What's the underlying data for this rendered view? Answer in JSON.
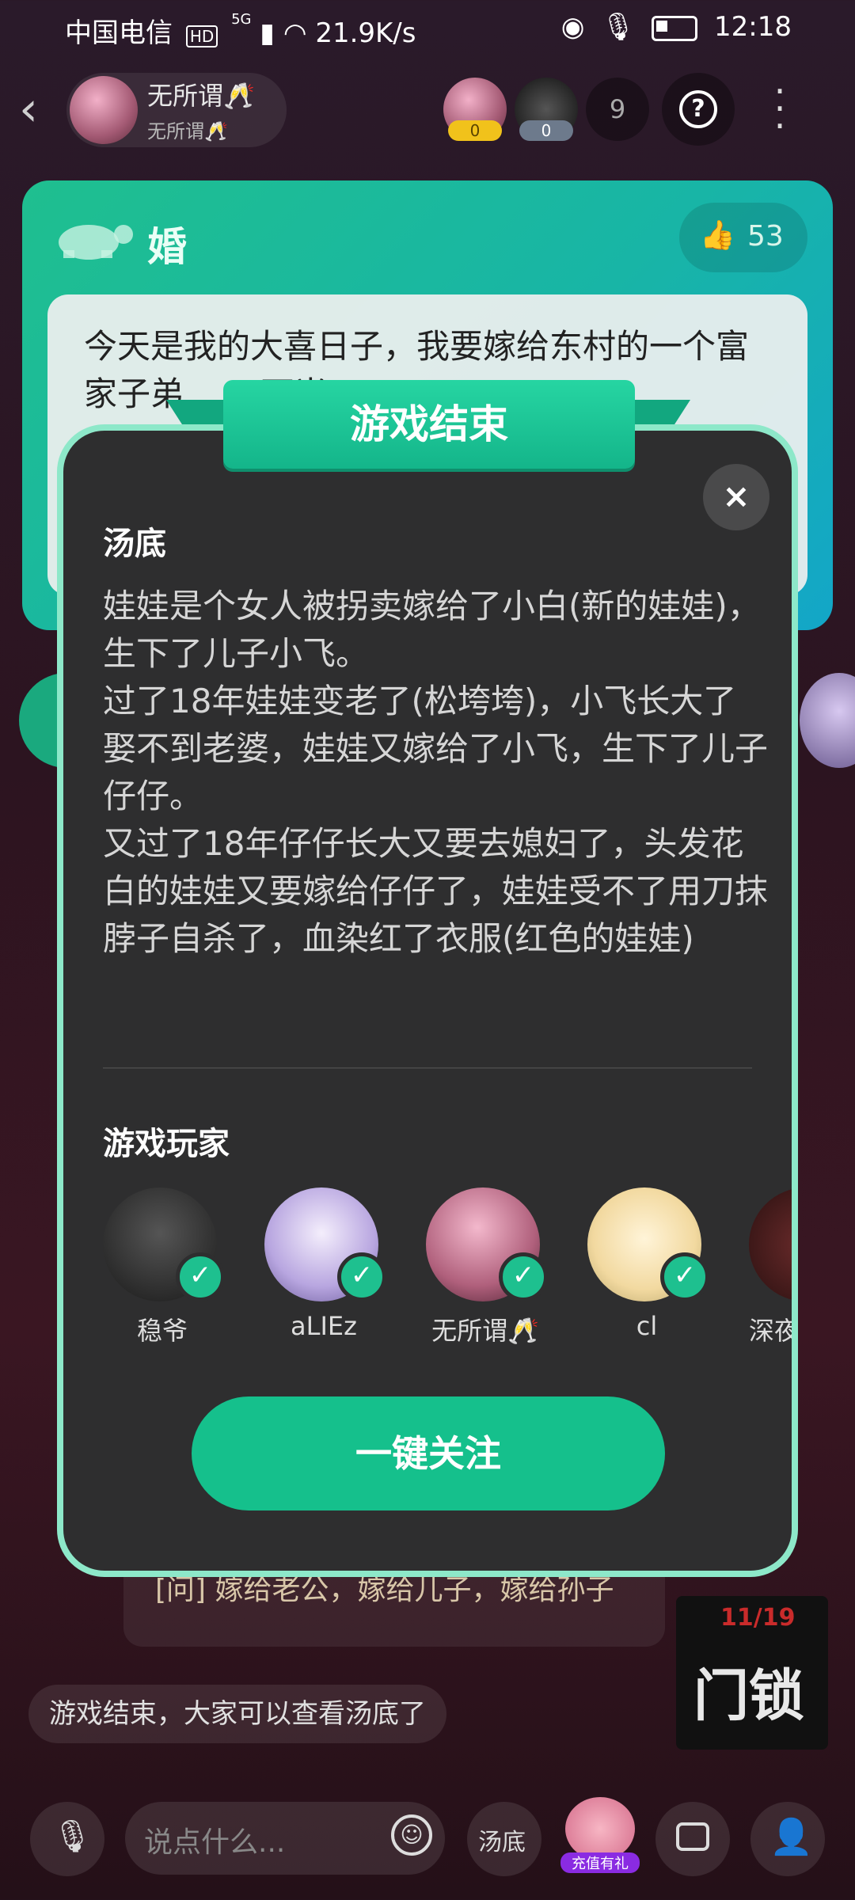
{
  "status_bar": {
    "carrier": "中国电信",
    "speed": "21.9K/s",
    "time": "12:18",
    "net": "5G"
  },
  "header": {
    "host_name": "无所谓🥂",
    "host_subtitle": "无所谓🥂",
    "player_badge_1": "0",
    "player_badge_2": "0",
    "audience_count": "9"
  },
  "question_card": {
    "title": "婚",
    "likes": "53",
    "text": "今天是我的大喜日子，我要嫁给东村的一个富家子弟……  可当"
  },
  "modal": {
    "banner": "游戏结束",
    "answer_title": "汤底",
    "answer_text": "娃娃是个女人被拐卖嫁给了小白(新的娃娃)，生下了儿子小飞。\n过了18年娃娃变老了(松垮垮)，小飞长大了娶不到老婆，娃娃又嫁给了小飞，生下了儿子仔仔。\n又过了18年仔仔长大又要去媳妇了，头发花白的娃娃又要嫁给仔仔了，娃娃受不了用刀抹脖子自杀了，血染红了衣服(红色的娃娃)",
    "players_title": "游戏玩家",
    "players": [
      {
        "name": "稳爷"
      },
      {
        "name": "aLIEz"
      },
      {
        "name": "无所谓🥂"
      },
      {
        "name": "cl"
      },
      {
        "name": "深夜"
      }
    ],
    "follow_all": "一键关注"
  },
  "chat": {
    "bubble_text": "[问] 嫁给老公，嫁给儿子，嫁给孙子",
    "system_message": "游戏结束，大家可以查看汤底了",
    "promo_date": "11/19",
    "promo_title": "门锁"
  },
  "bottom_bar": {
    "input_placeholder": "说点什么...",
    "answer_button": "汤底",
    "gift_label": "充值有礼"
  },
  "colors": {
    "accent": "#15c08c",
    "modal_border": "#8de8c9",
    "modal_bg": "#2e2e2f"
  }
}
